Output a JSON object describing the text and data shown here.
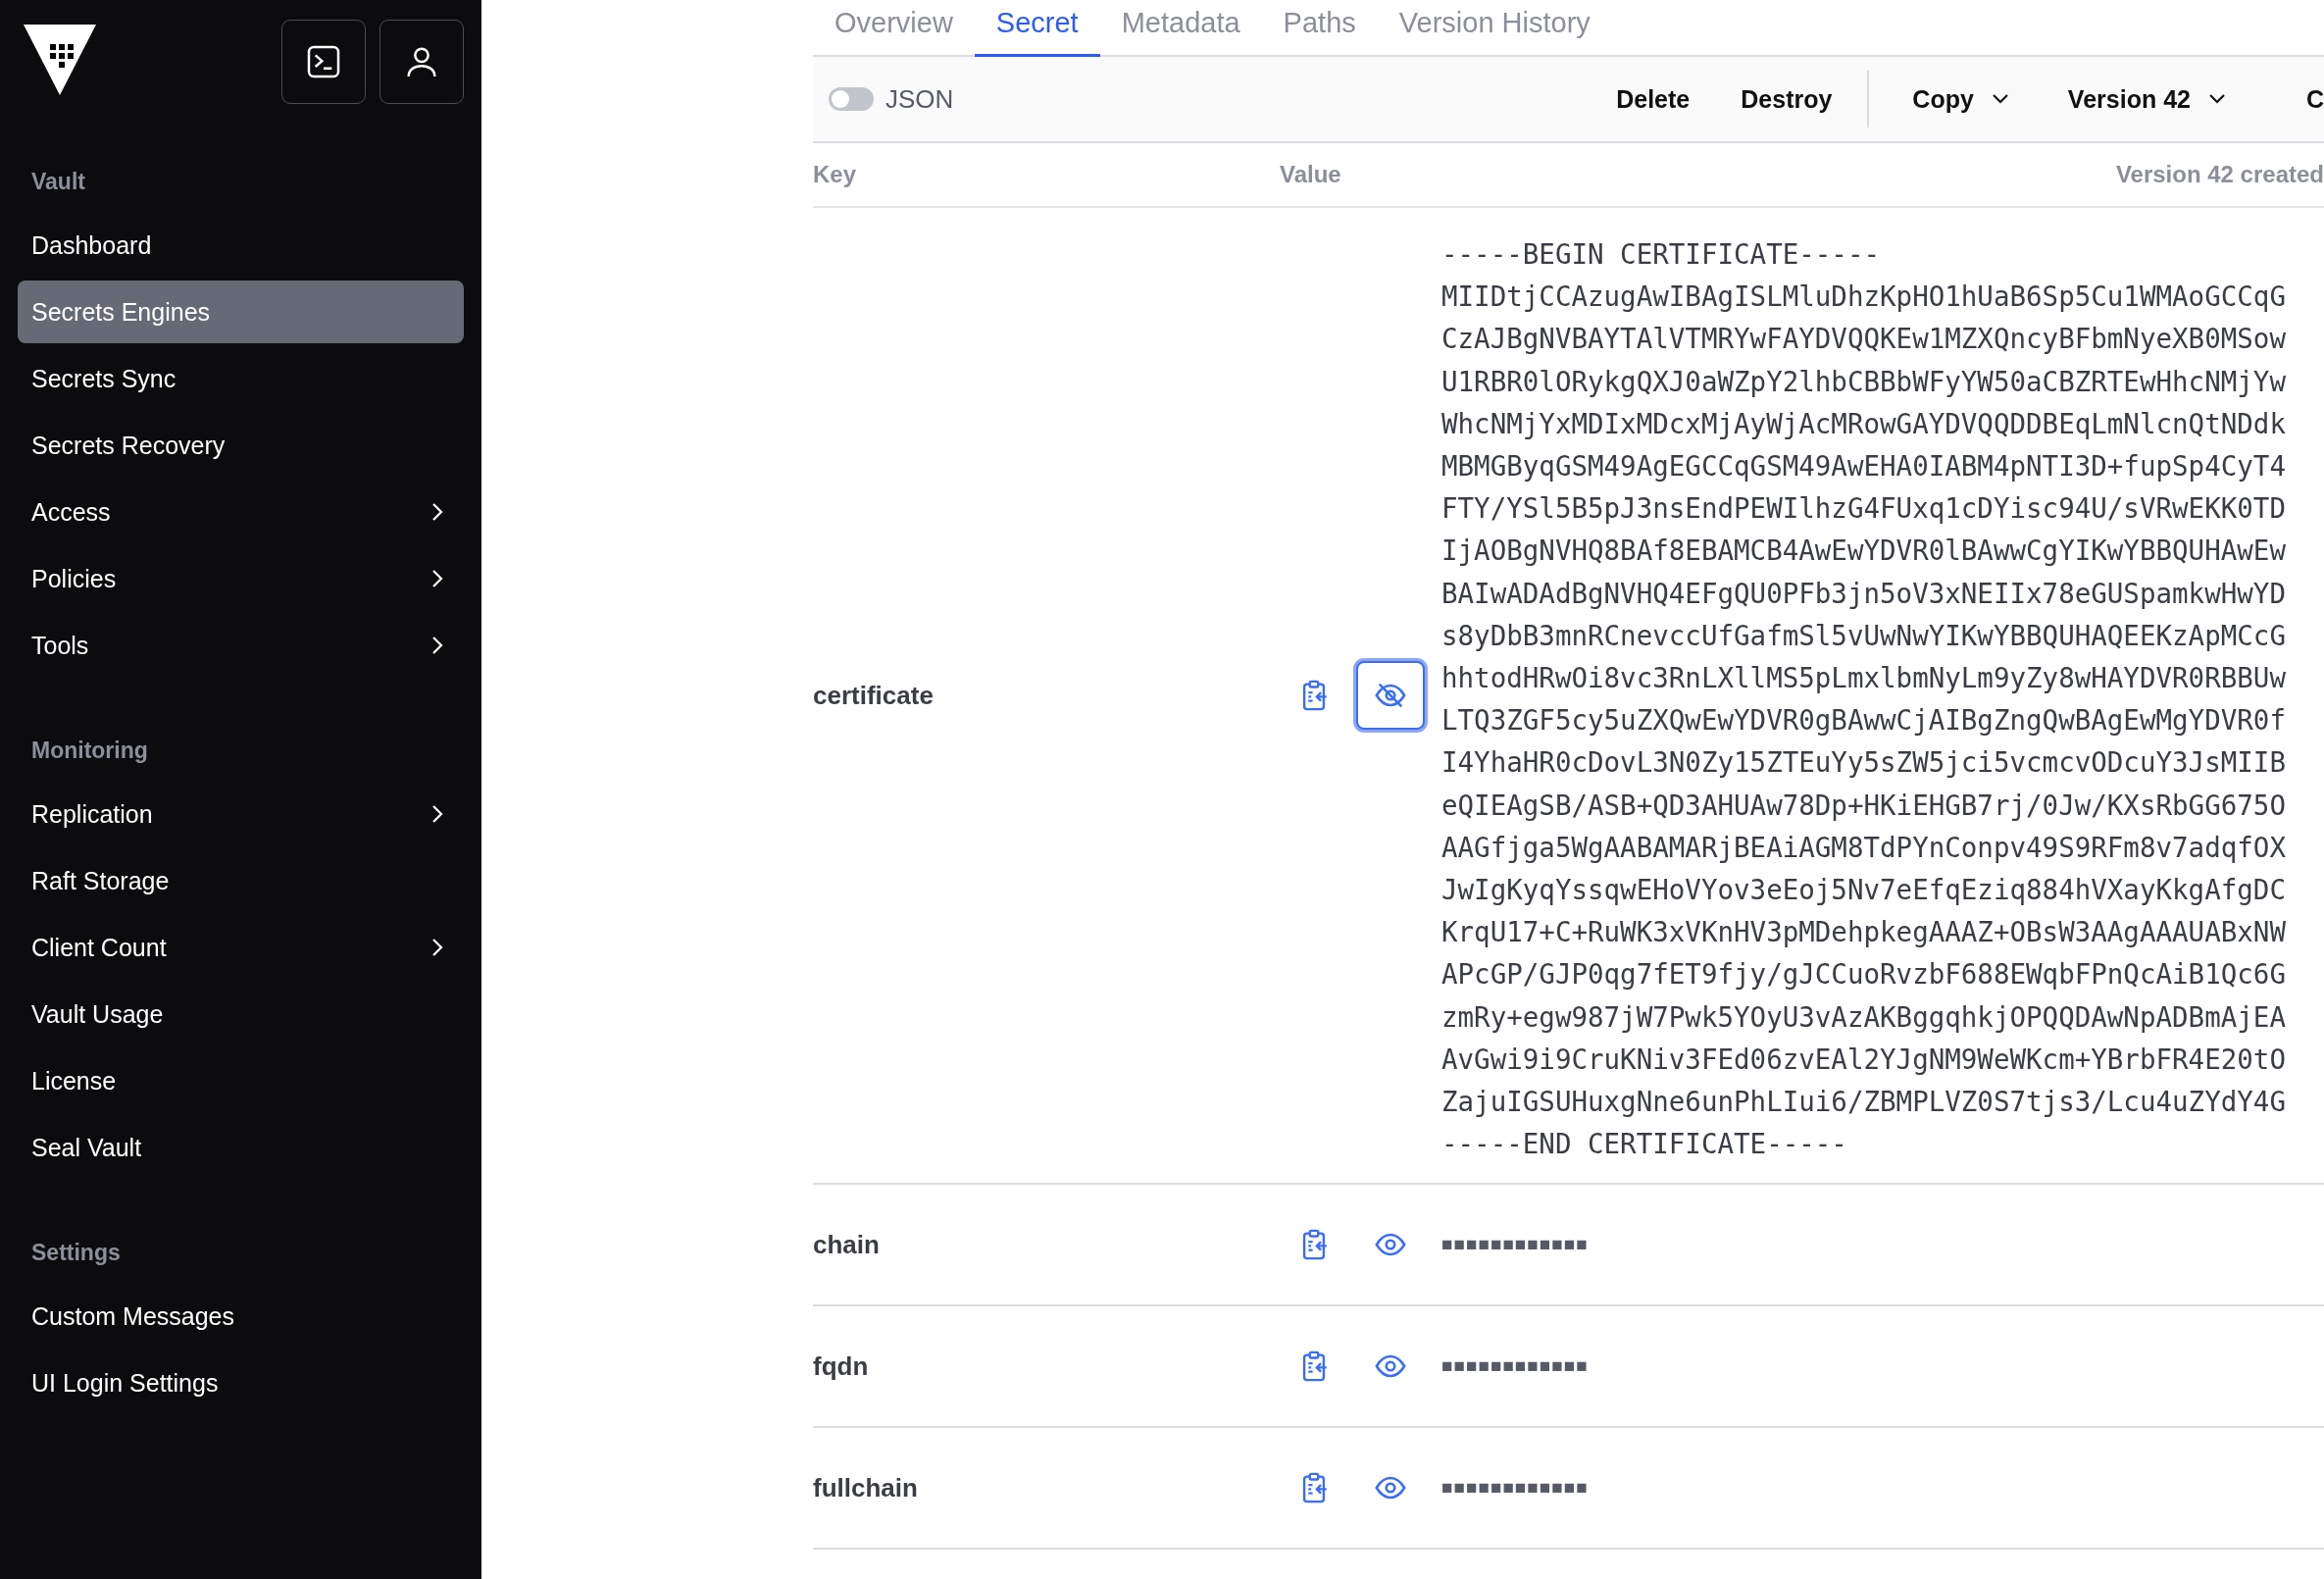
{
  "sidebar": {
    "sections": [
      {
        "heading": "Vault",
        "items": [
          {
            "label": "Dashboard",
            "selected": false,
            "expandable": false
          },
          {
            "label": "Secrets Engines",
            "selected": true,
            "expandable": false
          },
          {
            "label": "Secrets Sync",
            "selected": false,
            "expandable": false
          },
          {
            "label": "Secrets Recovery",
            "selected": false,
            "expandable": false
          },
          {
            "label": "Access",
            "selected": false,
            "expandable": true
          },
          {
            "label": "Policies",
            "selected": false,
            "expandable": true
          },
          {
            "label": "Tools",
            "selected": false,
            "expandable": true
          }
        ]
      },
      {
        "heading": "Monitoring",
        "items": [
          {
            "label": "Replication",
            "selected": false,
            "expandable": true
          },
          {
            "label": "Raft Storage",
            "selected": false,
            "expandable": false
          },
          {
            "label": "Client Count",
            "selected": false,
            "expandable": true
          },
          {
            "label": "Vault Usage",
            "selected": false,
            "expandable": false
          },
          {
            "label": "License",
            "selected": false,
            "expandable": false
          },
          {
            "label": "Seal Vault",
            "selected": false,
            "expandable": false
          }
        ]
      },
      {
        "heading": "Settings",
        "items": [
          {
            "label": "Custom Messages",
            "selected": false,
            "expandable": false
          },
          {
            "label": "UI Login Settings",
            "selected": false,
            "expandable": false
          }
        ]
      }
    ]
  },
  "tabs": [
    {
      "label": "Overview",
      "selected": false
    },
    {
      "label": "Secret",
      "selected": true
    },
    {
      "label": "Metadata",
      "selected": false
    },
    {
      "label": "Paths",
      "selected": false
    },
    {
      "label": "Version History",
      "selected": false
    }
  ],
  "toolbar": {
    "json_toggle": {
      "label": "JSON",
      "on": false
    },
    "actions": [
      "Delete",
      "Destroy"
    ],
    "dropdowns": [
      "Copy",
      "Version 42"
    ],
    "cut_button": "C"
  },
  "table": {
    "columns": [
      "Key",
      "Value"
    ],
    "version_note": "Version 42 created",
    "rows": [
      {
        "key": "certificate",
        "revealed": true,
        "value_lines": [
          "-----BEGIN CERTIFICATE-----",
          "MIIDtjCCAzugAwIBAgISLMluDhzKpHO1hUaB6Sp5Cu1WMAoGCCqG",
          "CzAJBgNVBAYTAlVTMRYwFAYDVQQKEw1MZXQncyBFbmNyeXB0MSow",
          "U1RBR0lORykgQXJ0aWZpY2lhbCBBbWFyYW50aCBZRTEwHhcNMjYw",
          "WhcNMjYxMDIxMDcxMjAyWjAcMRowGAYDVQQDDBEqLmNlcnQtNDdk",
          "MBMGByqGSM49AgEGCCqGSM49AwEHA0IABM4pNTI3D+fupSp4CyT4",
          "FTY/YSl5B5pJ3nsEndPEWIlhzG4FUxq1cDYisc94U/sVRwEKK0TD",
          "IjAOBgNVHQ8BAf8EBAMCB4AwEwYDVR0lBAwwCgYIKwYBBQUHAwEw",
          "BAIwADAdBgNVHQ4EFgQU0PFb3jn5oV3xNEIIx78eGUSpamkwHwYD",
          "s8yDbB3mnRCnevccUfGafmSl5vUwNwYIKwYBBQUHAQEEKzApMCcG",
          "hhtodHRwOi8vc3RnLXllMS5pLmxlbmNyLm9yZy8wHAYDVR0RBBUw",
          "LTQ3ZGF5cy5uZXQwEwYDVR0gBAwwCjAIBgZngQwBAgEwMgYDVR0f",
          "I4YhaHR0cDovL3N0Zy15ZTEuYy5sZW5jci5vcmcvODcuY3JsMIIB",
          "eQIEAgSB/ASB+QD3AHUAw78Dp+HKiEHGB7rj/0Jw/KXsRbGG675O",
          "AAGfjga5WgAABAMARjBEAiAGM8TdPYnConpv49S9RFm8v7adqfOX",
          "JwIgKyqYssqwEHoVYov3eEoj5Nv7eEfqEziq884hVXayKkgAfgDC",
          "KrqU17+C+RuWK3xVKnHV3pMDehpkegAAAZ+OBsW3AAgAAAUABxNW",
          "APcGP/GJP0qg7fET9fjy/gJCCuoRvzbF688EWqbFPnQcAiB1Qc6G",
          "zmRy+egw987jW7Pwk5YOyU3vAzAKBggqhkjOPQQDAwNpADBmAjEA",
          "AvGwi9i9CruKNiv3FEd06zvEAl2YJgNM9WeWKcm+YBrbFR4E20tO",
          "ZajuIGSUHuxgNne6unPhLIui6/ZBMPLVZ0S7tjs3/Lcu4uZYdY4G",
          "-----END CERTIFICATE-----"
        ]
      },
      {
        "key": "chain",
        "revealed": false,
        "masked": "■■■■■■■■■■■■"
      },
      {
        "key": "fqdn",
        "revealed": false,
        "masked": "■■■■■■■■■■■■"
      },
      {
        "key": "fullchain",
        "revealed": false,
        "masked": "■■■■■■■■■■■■"
      }
    ]
  }
}
